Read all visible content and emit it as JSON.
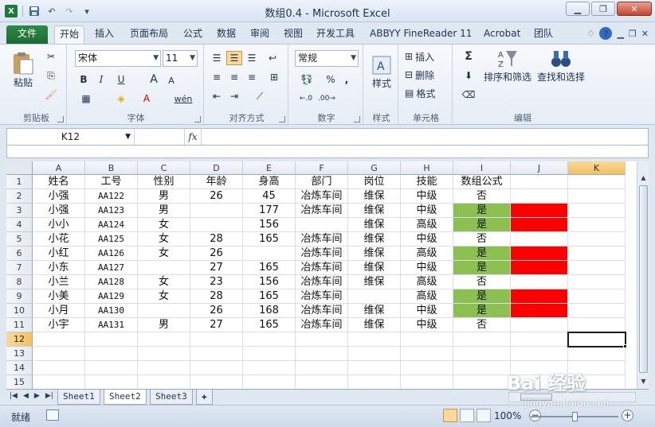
{
  "window": {
    "title": "数组0.4 - Microsoft Excel",
    "qat_icons": [
      "excel-icon",
      "save-icon",
      "undo-icon",
      "redo-icon",
      "customize-icon"
    ]
  },
  "tabs": [
    "文件",
    "开始",
    "插入",
    "页面布局",
    "公式",
    "数据",
    "审阅",
    "视图",
    "开发工具",
    "ABBYY FineReader 11",
    "Acrobat",
    "团队"
  ],
  "active_tab": "开始",
  "ribbon": {
    "clipboard": {
      "label": "剪贴板",
      "paste": "粘贴"
    },
    "font": {
      "label": "字体",
      "name": "宋体",
      "size": "11",
      "bold": "B",
      "italic": "I",
      "underline": "U",
      "grow": "A",
      "shrink": "A",
      "color_a": "A",
      "wen": "wén"
    },
    "alignment": {
      "label": "对齐方式"
    },
    "number": {
      "label": "数字",
      "format": "常规",
      "percent": "%",
      "comma": ","
    },
    "styles": {
      "label": "样式",
      "btn": "样式"
    },
    "cells": {
      "label": "单元格",
      "insert": "插入",
      "delete": "删除",
      "format": "格式"
    },
    "editing": {
      "label": "编辑",
      "sort_filter": "排序和筛选",
      "find_select": "查找和选择",
      "sigma": "Σ"
    }
  },
  "formula_bar": {
    "name_box": "K12",
    "fx": "fx",
    "content": ""
  },
  "columns": [
    "A",
    "B",
    "C",
    "D",
    "E",
    "F",
    "G",
    "H",
    "I",
    "J",
    "K"
  ],
  "selected_column": "K",
  "selected_row": "12",
  "rows": [
    {
      "n": "1",
      "cells": [
        "姓名",
        "工号",
        "性别",
        "年龄",
        "身高",
        "部门",
        "岗位",
        "技能",
        "数组公式",
        "",
        ""
      ]
    },
    {
      "n": "2",
      "cells": [
        "小强",
        "AA122",
        "男",
        "26",
        "45",
        "冶炼车间",
        "维保",
        "中级",
        "否",
        "",
        ""
      ]
    },
    {
      "n": "3",
      "cells": [
        "小强",
        "AA123",
        "男",
        "",
        "177",
        "冶炼车间",
        "维保",
        "中级",
        "是",
        "",
        ""
      ]
    },
    {
      "n": "4",
      "cells": [
        "小小",
        "AA124",
        "女",
        "",
        "156",
        "",
        "维保",
        "高级",
        "是",
        "",
        ""
      ]
    },
    {
      "n": "5",
      "cells": [
        "小花",
        "AA125",
        "女",
        "28",
        "165",
        "冶炼车间",
        "维保",
        "中级",
        "否",
        "",
        ""
      ]
    },
    {
      "n": "6",
      "cells": [
        "小红",
        "AA126",
        "女",
        "26",
        "",
        "冶炼车间",
        "维保",
        "高级",
        "是",
        "",
        ""
      ]
    },
    {
      "n": "7",
      "cells": [
        "小东",
        "AA127",
        "",
        "27",
        "165",
        "冶炼车间",
        "维保",
        "中级",
        "是",
        "",
        ""
      ]
    },
    {
      "n": "8",
      "cells": [
        "小兰",
        "AA128",
        "女",
        "23",
        "156",
        "冶炼车间",
        "维保",
        "高级",
        "否",
        "",
        ""
      ]
    },
    {
      "n": "9",
      "cells": [
        "小美",
        "AA129",
        "女",
        "28",
        "165",
        "冶炼车间",
        "",
        "高级",
        "是",
        "",
        ""
      ]
    },
    {
      "n": "10",
      "cells": [
        "小月",
        "AA130",
        "",
        "26",
        "168",
        "冶炼车间",
        "维保",
        "中级",
        "是",
        "",
        ""
      ]
    },
    {
      "n": "11",
      "cells": [
        "小宇",
        "AA131",
        "男",
        "27",
        "165",
        "冶炼车间",
        "维保",
        "中级",
        "否",
        "",
        ""
      ]
    },
    {
      "n": "12",
      "cells": [
        "",
        "",
        "",
        "",
        "",
        "",
        "",
        "",
        "",
        "",
        ""
      ]
    },
    {
      "n": "13",
      "cells": [
        "",
        "",
        "",
        "",
        "",
        "",
        "",
        "",
        "",
        "",
        ""
      ]
    },
    {
      "n": "14",
      "cells": [
        "",
        "",
        "",
        "",
        "",
        "",
        "",
        "",
        "",
        "",
        ""
      ]
    },
    {
      "n": "15",
      "cells": [
        "",
        "",
        "",
        "",
        "",
        "",
        "",
        "",
        "",
        "",
        ""
      ]
    }
  ],
  "colors": {
    "green_fill": "#8cc152",
    "red_fill": "#ff0000",
    "file_tab": "#1f7a3a"
  },
  "sheets": [
    "Sheet1",
    "Sheet2",
    "Sheet3"
  ],
  "active_sheet": "Sheet2",
  "status": {
    "ready": "就绪",
    "zoom": "100%"
  },
  "watermark": {
    "main": "Bai 经验",
    "sub": "jingyan.baidu.com"
  }
}
